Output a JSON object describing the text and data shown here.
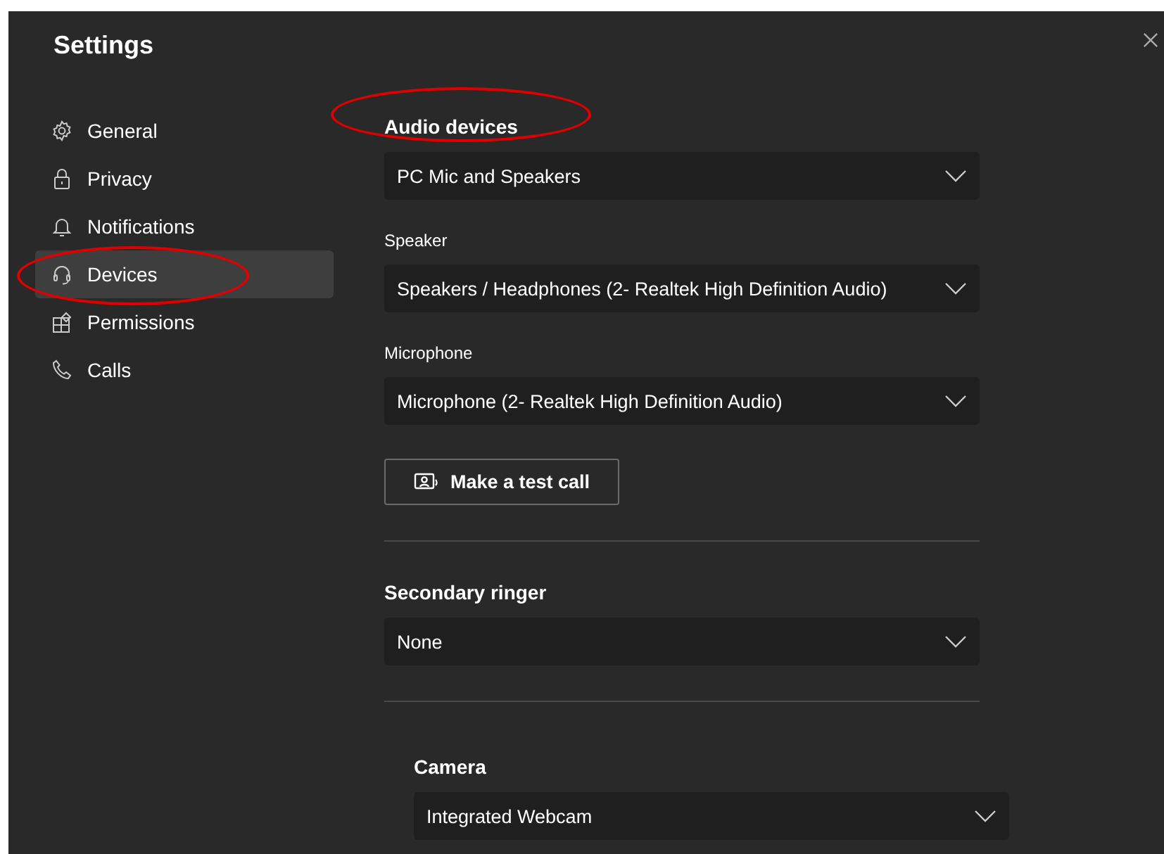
{
  "window": {
    "title": "Settings"
  },
  "sidebar": {
    "items": [
      {
        "label": "General",
        "kind": "gear",
        "selected": false,
        "circled": false
      },
      {
        "label": "Privacy",
        "kind": "lock",
        "selected": false,
        "circled": false
      },
      {
        "label": "Notifications",
        "kind": "bell",
        "selected": false,
        "circled": false
      },
      {
        "label": "Devices",
        "kind": "headset",
        "selected": true,
        "circled": true
      },
      {
        "label": "Permissions",
        "kind": "apps",
        "selected": false,
        "circled": false
      },
      {
        "label": "Calls",
        "kind": "phone",
        "selected": false,
        "circled": false
      }
    ]
  },
  "content": [
    {
      "kind": "heading",
      "text": "Audio devices",
      "circled": true
    },
    {
      "kind": "dropdown",
      "value": "PC Mic and Speakers"
    },
    {
      "kind": "label",
      "text": "Speaker"
    },
    {
      "kind": "dropdown",
      "value": "Speakers / Headphones (2- Realtek High Definition Audio)"
    },
    {
      "kind": "label",
      "text": "Microphone"
    },
    {
      "kind": "dropdown",
      "value": "Microphone (2- Realtek High Definition Audio)"
    },
    {
      "kind": "button",
      "text": "Make a test call"
    },
    {
      "kind": "divider"
    },
    {
      "kind": "heading",
      "text": "Secondary ringer",
      "circled": false
    },
    {
      "kind": "dropdown",
      "value": "None"
    },
    {
      "kind": "divider"
    },
    {
      "kind": "group",
      "children": [
        {
          "kind": "heading",
          "text": "Camera",
          "circled": false
        },
        {
          "kind": "dropdown",
          "value": "Integrated Webcam"
        }
      ]
    }
  ]
}
